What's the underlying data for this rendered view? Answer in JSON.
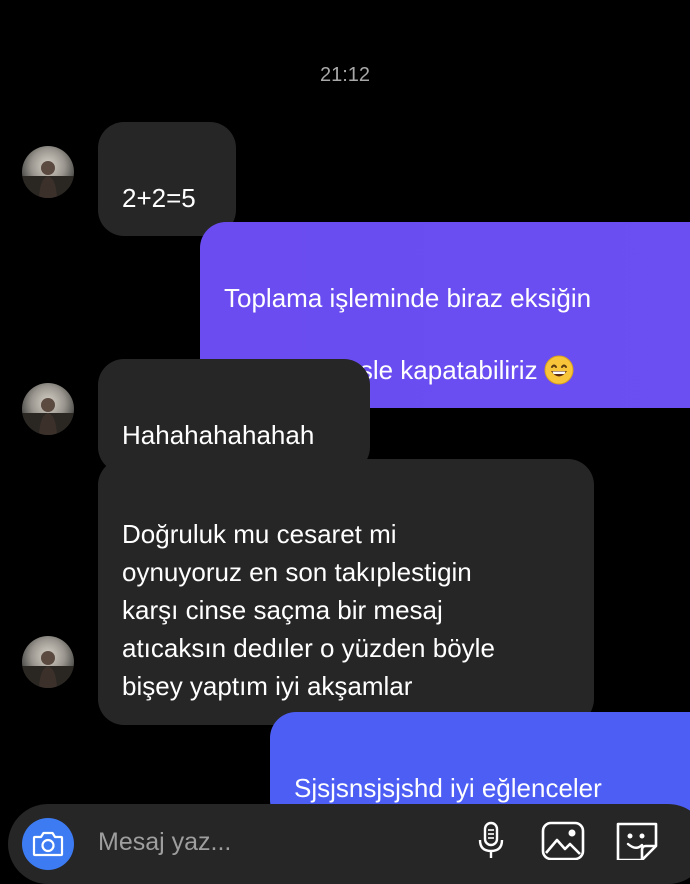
{
  "conversation": {
    "timestamp": "21:12",
    "messages": [
      {
        "sender": "contact",
        "text": "2+2=5"
      },
      {
        "sender": "me",
        "text": "Toplama işleminde biraz eksiğin\nvar özel dersle kapatabiliriz",
        "emoji": "grinning-smiling-eyes-emoji"
      },
      {
        "sender": "contact",
        "text": "Hahahahahahah"
      },
      {
        "sender": "contact",
        "text": "Doğruluk mu cesaret mi\noynuyoruz en son takıplestigin\nkarşı cinse saçma bir mesaj\natıcaksın dedıler o yüzden böyle\nbişey yaptım iyi akşamlar"
      },
      {
        "sender": "me",
        "text": "Sjsjsnsjsjshd  iyi eğlenceler"
      }
    ]
  },
  "composer": {
    "placeholder": "Mesaj yaz...",
    "icons": [
      "camera-icon",
      "microphone-icon",
      "gallery-icon",
      "sticker-icon"
    ]
  },
  "colors": {
    "background": "#000000",
    "incoming_bubble": "#262626",
    "outgoing_bubble": "#6a4cf0",
    "outgoing_bubble_last": "#4d5ef5",
    "camera_button": "#3d7bf3",
    "timestamp": "#a8a8a8"
  }
}
